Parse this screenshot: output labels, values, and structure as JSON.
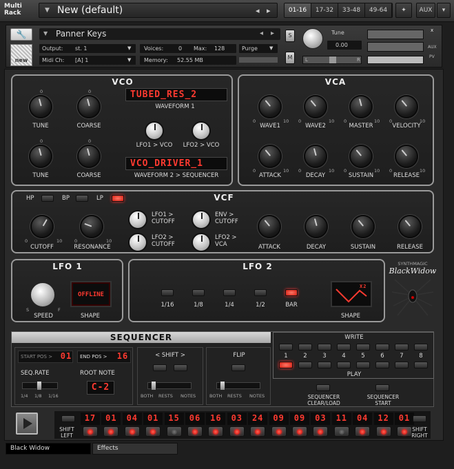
{
  "rack": {
    "title_line1": "Multi",
    "title_line2": "Rack",
    "preset": "New (default)",
    "ranges": [
      "01-16",
      "17-32",
      "33-48",
      "49-64"
    ],
    "aux": "AUX"
  },
  "instrument": {
    "name": "Panner Keys",
    "output_label": "Output:",
    "output_value": "st. 1",
    "voices_label": "Voices:",
    "voices_value": "0",
    "max_label": "Max:",
    "max_value": "128",
    "purge": "Purge",
    "midi_label": "Midi Ch:",
    "midi_value": "[A]  1",
    "memory_label": "Memory:",
    "memory_value": "52.55 MB",
    "new_label": "new",
    "s_btn": "S",
    "m_btn": "M",
    "tune_label": "Tune",
    "tune_value": "0.00",
    "pan_l": "L",
    "pan_r": "R",
    "aux_lbl": "AUX",
    "pv_lbl": "PV",
    "x_lbl": "x"
  },
  "vco": {
    "title": "VCO",
    "waveform1_display": "TUBED_RES_2",
    "waveform1_label": "WAVEFORM 1",
    "waveform2_display": "VCO_DRIVER_1",
    "waveform2_label": "WAVEFORM 2  >  SEQUENCER",
    "tune": "TUNE",
    "coarse": "COARSE",
    "lfo1_vco": "LFO1 > VCO",
    "lfo2_vco": "LFO2 > VCO",
    "zero": "0"
  },
  "vca": {
    "title": "VCA",
    "knobs": [
      "WAVE1",
      "WAVE2",
      "MASTER",
      "VELOCITY",
      "ATTACK",
      "DECAY",
      "SUSTAIN",
      "RELEASE"
    ],
    "min": "0",
    "max": "10"
  },
  "vcf": {
    "title": "VCF",
    "hp": "HP",
    "bp": "BP",
    "lp": "LP",
    "cutoff": "CUTOFF",
    "resonance": "RESONANCE",
    "lfo1_cutoff_a": "LFO1 >",
    "lfo1_cutoff_b": "CUTOFF",
    "lfo2_cutoff_a": "LFO2 >",
    "lfo2_cutoff_b": "CUTOFF",
    "env_cutoff_a": "ENV >",
    "env_cutoff_b": "CUTOFF",
    "lfo2_vca_a": "LFO2 >",
    "lfo2_vca_b": "VCA",
    "attack": "ATTACK",
    "decay": "DECAY",
    "sustain": "SUSTAIN",
    "release": "RELEASE",
    "min": "0",
    "max": "10"
  },
  "lfo1": {
    "title": "LFO 1",
    "speed": "SPEED",
    "shape": "SHAPE",
    "shape_display": "OFFLINE",
    "s": "S",
    "f": "F"
  },
  "lfo2": {
    "title": "LFO 2",
    "rates": [
      "1/16",
      "1/8",
      "1/4",
      "1/2",
      "BAR"
    ],
    "shape": "SHAPE",
    "shape_badge": "X2"
  },
  "brand": {
    "line1": "SYNTHMAGIC",
    "line2": "BlackWidow"
  },
  "sequencer": {
    "title": "SEQUENCER",
    "start_pos_label": "START POS >",
    "start_pos": "01",
    "end_pos_label": "END POS >",
    "end_pos": "16",
    "seq_rate": "SEQ.RATE",
    "rate_ticks": [
      "1/4",
      "1/8",
      "1/16"
    ],
    "root_note": "ROOT NOTE",
    "root_value": "C-2",
    "shift": "<  SHIFT  >",
    "flip": "FLIP",
    "both": "BOTH",
    "rests": "RESTS",
    "notes": "NOTES",
    "write": "WRITE",
    "play": "PLAY",
    "slots": [
      "1",
      "2",
      "3",
      "4",
      "5",
      "6",
      "7",
      "8"
    ],
    "clear_load_a": "SEQUENCER",
    "clear_load_b": "CLEAR/LOAD",
    "start_a": "SEQUENCER",
    "start_b": "START",
    "shift_left_a": "SHIFT",
    "shift_left_b": "LEFT",
    "shift_right_a": "SHIFT",
    "shift_right_b": "RIGHT",
    "steps": [
      "17",
      "01",
      "04",
      "01",
      "15",
      "06",
      "16",
      "03",
      "24",
      "09",
      "09",
      "03",
      "11",
      "04",
      "12",
      "01"
    ],
    "step_on": [
      1,
      1,
      1,
      1,
      0,
      1,
      1,
      1,
      1,
      1,
      1,
      1,
      0,
      1,
      1,
      1
    ]
  },
  "tabs": {
    "first": "Black Widow",
    "second": "Effects"
  }
}
